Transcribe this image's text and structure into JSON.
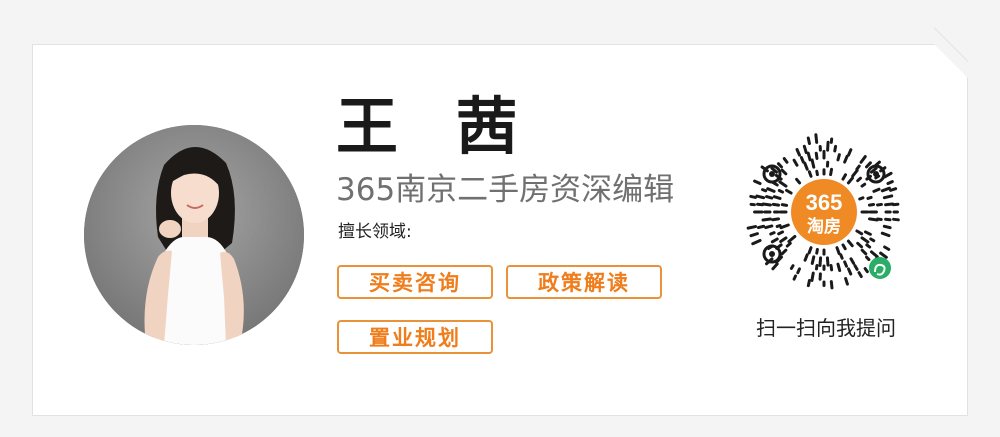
{
  "profile": {
    "name": "王 茜",
    "role": "365南京二手房资深编辑",
    "expertise_label": "擅长领域:"
  },
  "tags": [
    {
      "label": "买卖咨询"
    },
    {
      "label": "政策解读"
    },
    {
      "label": "置业规划"
    }
  ],
  "qr": {
    "logo_line1": "365",
    "logo_line2": "淘房",
    "caption": "扫一扫向我提问"
  },
  "colors": {
    "accent": "#ef7d1b",
    "tag_border": "#e8923a",
    "brand_orange": "#f08a24",
    "miniprogram_green": "#2aae67"
  }
}
